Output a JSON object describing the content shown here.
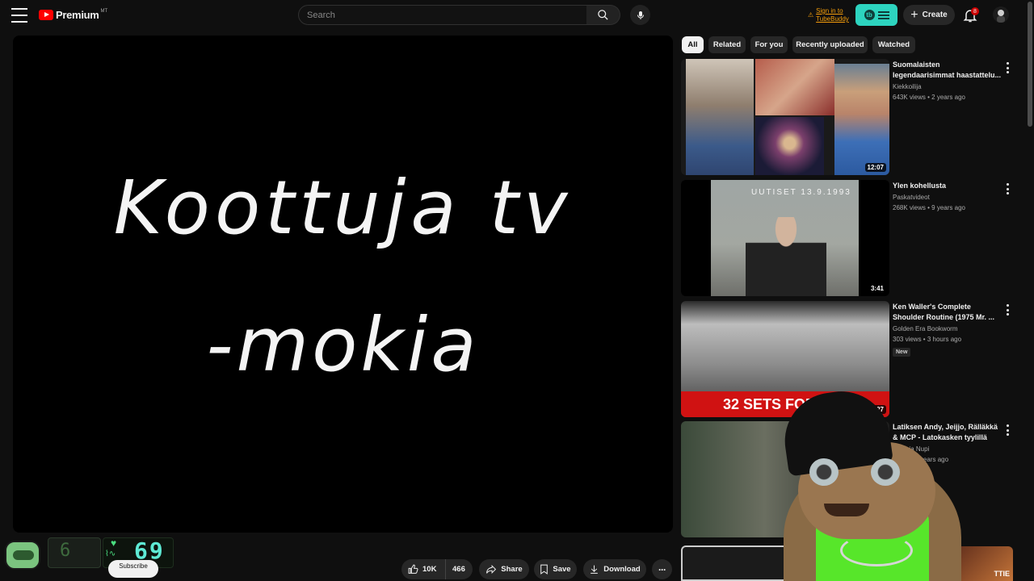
{
  "header": {
    "logo_text": "Premium",
    "logo_superscript": "MT",
    "search_placeholder": "Search",
    "tubebuddy_signin": "Sign in to TubeBuddy",
    "create_label": "Create",
    "notification_count": "8"
  },
  "player": {
    "line1": "Koottuja tv",
    "line2": "-mokia"
  },
  "actions": {
    "like_count": "10K",
    "dislike_count": "466",
    "share_label": "Share",
    "save_label": "Save",
    "download_label": "Download",
    "more_label": "···",
    "subscribe_label": "Subscribe"
  },
  "overlay": {
    "left_digit": "6",
    "heart_rate": "69"
  },
  "chips": [
    {
      "label": "All",
      "active": true
    },
    {
      "label": "Related"
    },
    {
      "label": "For you"
    },
    {
      "label": "Recently uploaded"
    },
    {
      "label": "Watched"
    }
  ],
  "recommendations": [
    {
      "title": "Suomalaisten legendaarisimmat haastattelu...",
      "channel": "Kiekkoilija",
      "stats": "643K views • 2 years ago",
      "duration": "12:07"
    },
    {
      "title": "Ylen kohellusta",
      "channel": "Paskatvideot",
      "stats": "268K views • 9 years ago",
      "duration": "3:41",
      "thumb_text": "UUTISET 13.9.1993"
    },
    {
      "title": "Ken Waller's Complete Shoulder Routine (1975 Mr. ...",
      "channel": "Golden Era Bookworm",
      "stats": "303 views • 3 hours ago",
      "duration": "5:27",
      "badge": "New",
      "thumb_text": "32 SETS FOR"
    },
    {
      "title": "Latiksen Andy, Jeijjo, Rälläkkä & MCP - Latokasken tyylillä",
      "channel": "Jeijjo ja Nupi",
      "stats": "views • 2 years ago"
    }
  ],
  "corner_thumb_text": "TTIE",
  "colors": {
    "background": "#0f0f0f",
    "brand_red": "#ff0000",
    "tubebuddy_teal": "#2dd4bf",
    "overlay_green": "#4ade80"
  }
}
